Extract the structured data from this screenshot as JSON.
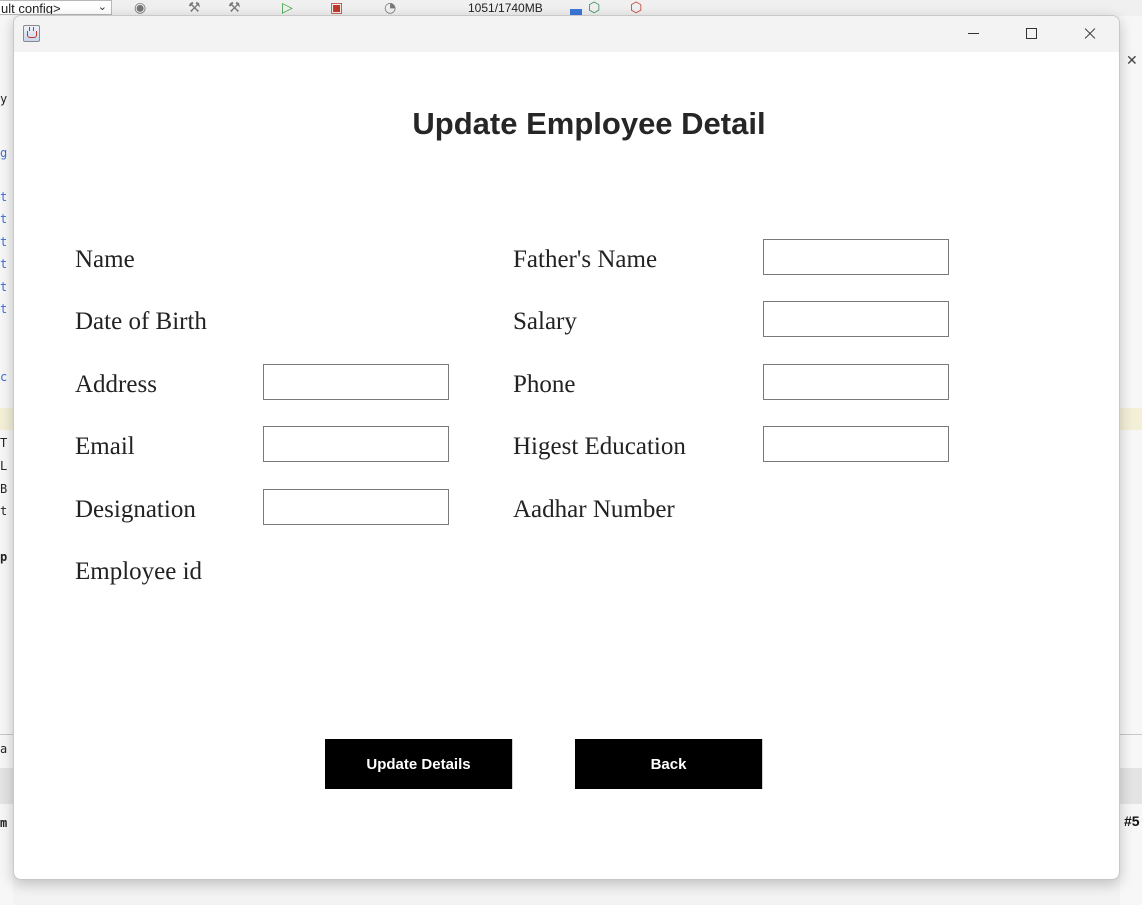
{
  "ide": {
    "config_label": "ult config>",
    "memory_text": "1051/1740MB",
    "right_tag": "#5",
    "left_fragments": [
      "y",
      "g",
      "t",
      "t",
      "t",
      "t",
      "t",
      "t",
      "c",
      "T",
      "L",
      "B",
      "t",
      "p",
      "a",
      "m"
    ]
  },
  "window": {
    "title": ""
  },
  "form": {
    "heading": "Update Employee Detail",
    "labels": {
      "name": "Name",
      "fathers_name": "Father's Name",
      "dob": "Date of Birth",
      "salary": "Salary",
      "address": "Address",
      "phone": "Phone",
      "email": "Email",
      "education": "Higest Education",
      "designation": "Designation",
      "aadhar": "Aadhar Number",
      "employee_id": "Employee id"
    },
    "values": {
      "fathers_name": "",
      "salary": "",
      "address": "",
      "phone": "",
      "email": "",
      "education": "",
      "designation": ""
    }
  },
  "buttons": {
    "update": "Update Details",
    "back": "Back"
  }
}
